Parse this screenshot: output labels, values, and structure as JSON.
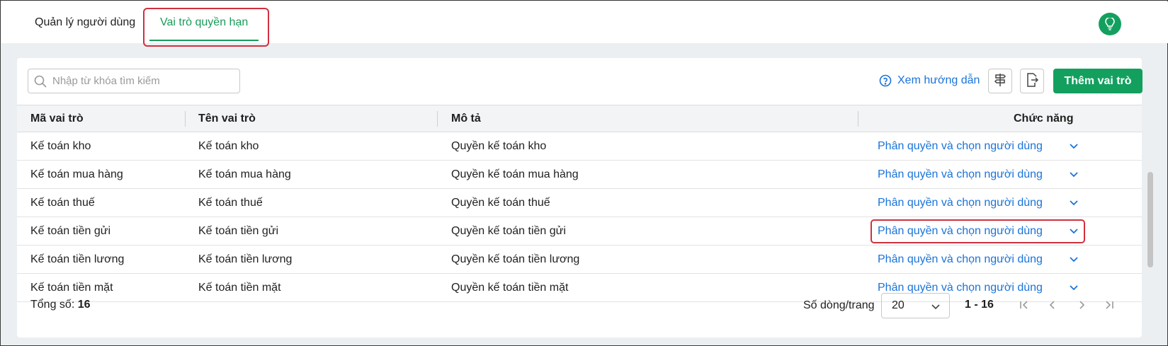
{
  "tabs": {
    "users": "Quản lý người dùng",
    "roles": "Vai trò quyền hạn"
  },
  "toolbar": {
    "search_placeholder": "Nhập từ khóa tìm kiếm",
    "guide_label": "Xem hướng dẫn",
    "add_label": "Thêm vai trò"
  },
  "table": {
    "headers": {
      "code": "Mã vai trò",
      "name": "Tên vai trò",
      "description": "Mô tả",
      "actions": "Chức năng"
    },
    "rows": [
      {
        "code": "Kế toán kho",
        "name": "Kế toán kho",
        "description": "Quyền kế toán kho",
        "action": "Phân quyền và chọn người dùng"
      },
      {
        "code": "Kế toán mua hàng",
        "name": "Kế toán mua hàng",
        "description": "Quyền kế toán mua hàng",
        "action": "Phân quyền và chọn người dùng"
      },
      {
        "code": "Kế toán thuế",
        "name": "Kế toán thuế",
        "description": "Quyền kế toán thuế",
        "action": "Phân quyền và chọn người dùng"
      },
      {
        "code": "Kế toán tiền gửi",
        "name": "Kế toán tiền gửi",
        "description": "Quyền kế toán tiền gửi",
        "action": "Phân quyền và chọn người dùng"
      },
      {
        "code": "Kế toán tiền lương",
        "name": "Kế toán tiền lương",
        "description": "Quyền kế toán tiền lương",
        "action": "Phân quyền và chọn người dùng"
      },
      {
        "code": "Kế toán tiền mặt",
        "name": "Kế toán tiền mặt",
        "description": "Quyền kế toán tiền mặt",
        "action": "Phân quyền và chọn người dùng"
      }
    ]
  },
  "footer": {
    "total_label": "Tổng số:",
    "total_value": "16",
    "rows_per_page_label": "Số dòng/trang",
    "rows_per_page_value": "20",
    "range": "1 - 16"
  },
  "colors": {
    "accent": "#13a05f",
    "link": "#1a73d9",
    "highlight": "#d0303f"
  }
}
